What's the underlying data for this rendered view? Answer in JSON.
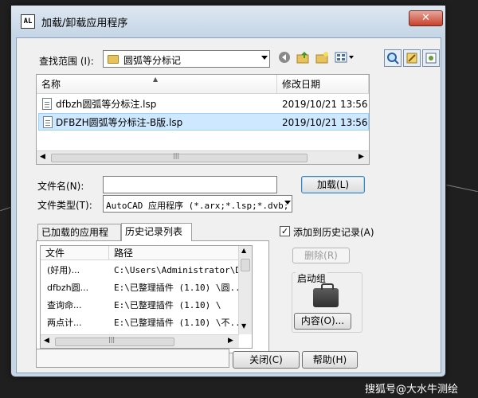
{
  "window": {
    "title": "加载/卸载应用程序",
    "app_icon": "AL",
    "close_symbol": "✕"
  },
  "lookin": {
    "label": "查找范围 (I):",
    "value": "圆弧等分标记"
  },
  "toolbar": {
    "back_icon": "back-arrow-icon",
    "up_icon": "up-folder-icon",
    "new_folder_icon": "new-folder-icon",
    "views_icon": "views-menu-icon",
    "find_icon": "find-icon",
    "tools_icon": "tools-icon",
    "options_icon": "options-icon"
  },
  "file_list": {
    "columns": [
      "名称",
      "修改日期"
    ],
    "rows": [
      {
        "name": "dfbzh圆弧等分标注.lsp",
        "date": "2019/10/21 13:56",
        "selected": false
      },
      {
        "name": "DFBZH圆弧等分标注-B版.lsp",
        "date": "2019/10/21 13:56",
        "selected": true
      }
    ],
    "scroll_left": "◀",
    "scroll_right": "▶",
    "scroll_grip": "|||"
  },
  "filename": {
    "label": "文件名(N):",
    "value": ""
  },
  "filetype": {
    "label": "文件类型(T):",
    "value": "AutoCAD 应用程序 (*.arx;*.lsp;*.dvb;"
  },
  "load_button": "加载(L)",
  "tabs": [
    {
      "label": "已加载的应用程序",
      "active": false
    },
    {
      "label": "历史记录列表",
      "active": true
    }
  ],
  "history": {
    "columns": [
      "文件",
      "路径"
    ],
    "rows": [
      {
        "file": "(好用)...",
        "path": "C:\\Users\\Administrator\\De..."
      },
      {
        "file": "dfbzh圆...",
        "path": "E:\\已整理插件 (1.10) \\圆..."
      },
      {
        "file": "查询命...",
        "path": "E:\\已整理插件 (1.10) \\"
      },
      {
        "file": "两点计...",
        "path": "E:\\已整理插件 (1.10) \\不..."
      }
    ],
    "scroll_up": "▲",
    "scroll_down": "▼",
    "scroll_left": "◀",
    "scroll_right": "▶",
    "scroll_grip": "|||"
  },
  "add_to_history": {
    "label": "添加到历史记录(A)",
    "checked": true,
    "mark": "✓"
  },
  "remove_button": "删除(R)",
  "startup": {
    "label": "启动组",
    "contents_button": "内容(O)..."
  },
  "close_button": "关闭(C)",
  "help_button": "帮助(H)",
  "watermark": "搜狐号@大水牛测绘",
  "colors": {
    "selection": "#cde8ff",
    "title_bar": "#c7d6e6",
    "close": "#c7412c"
  }
}
